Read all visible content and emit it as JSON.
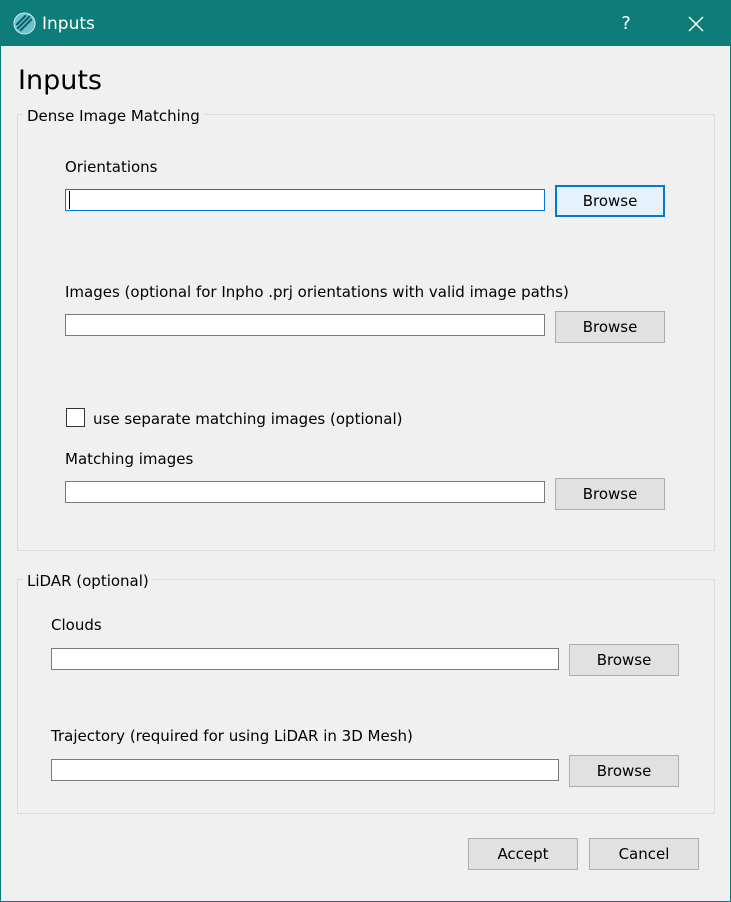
{
  "window": {
    "title": "Inputs",
    "help_symbol": "?",
    "title_color": "#0e7d7a"
  },
  "page": {
    "heading": "Inputs"
  },
  "dense_matching": {
    "group_title": "Dense Image Matching",
    "orientations_label": "Orientations",
    "orientations_value": "",
    "images_label": "Images (optional for Inpho .prj orientations with valid image paths)",
    "images_value": "",
    "separate_checkbox_label": "use separate matching images (optional)",
    "separate_checked": false,
    "matching_images_label": "Matching images",
    "matching_images_value": "",
    "browse_label": "Browse"
  },
  "lidar": {
    "group_title": "LiDAR (optional)",
    "clouds_label": "Clouds",
    "clouds_value": "",
    "trajectory_label": "Trajectory (required for using LiDAR in 3D Mesh)",
    "trajectory_value": "",
    "browse_label": "Browse"
  },
  "footer": {
    "accept_label": "Accept",
    "cancel_label": "Cancel"
  }
}
